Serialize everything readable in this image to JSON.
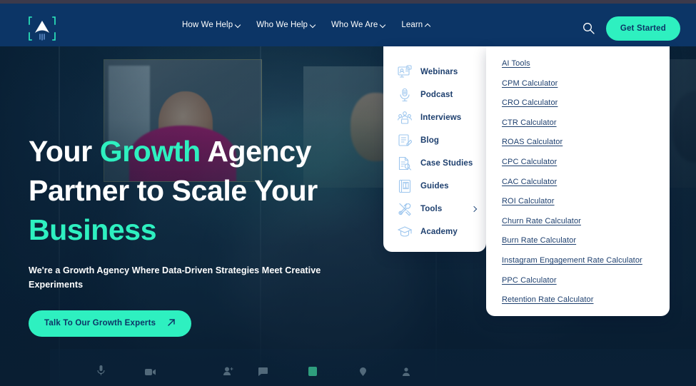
{
  "brand": {
    "logo_icon": "bracket-a-logo",
    "accent_color": "#2ef0c0",
    "header_color": "#0c3566",
    "text_dark": "#1d3f6e"
  },
  "header": {
    "nav": [
      {
        "label": "How We Help",
        "icon": "chevron-down-icon",
        "expanded": false
      },
      {
        "label": "Who We Help",
        "icon": "chevron-down-icon",
        "expanded": false
      },
      {
        "label": "Who We Are",
        "icon": "chevron-down-icon",
        "expanded": false
      },
      {
        "label": "Learn",
        "icon": "chevron-up-icon",
        "expanded": true
      }
    ],
    "search_icon": "search-icon",
    "cta_label": "Get Started"
  },
  "mega_menu": {
    "left_items": [
      {
        "label": "Webinars",
        "icon": "monitor-people-icon",
        "has_submenu": false
      },
      {
        "label": "Podcast",
        "icon": "microphone-icon",
        "has_submenu": false
      },
      {
        "label": "Interviews",
        "icon": "people-group-icon",
        "has_submenu": false
      },
      {
        "label": "Blog",
        "icon": "document-pencil-icon",
        "has_submenu": false
      },
      {
        "label": "Case Studies",
        "icon": "document-magnifier-icon",
        "has_submenu": false
      },
      {
        "label": "Guides",
        "icon": "book-icon",
        "has_submenu": false
      },
      {
        "label": "Tools",
        "icon": "tools-wrench-icon",
        "has_submenu": true
      },
      {
        "label": "Academy",
        "icon": "graduation-cap-icon",
        "has_submenu": false
      }
    ],
    "submenu_arrow_icon": "chevron-right-icon",
    "right_items": [
      "AI Tools",
      "CPM Calculator",
      "CRO Calculator",
      "CTR Calculator",
      "ROAS Calculator",
      "CPC Calculator",
      "CAC Calculator",
      "ROI Calculator",
      "Churn Rate Calculator",
      "Burn Rate Calculator",
      "Instagram Engagement Rate Calculator",
      "PPC Calculator",
      "Retention Rate Calculator"
    ]
  },
  "hero": {
    "heading_part1": "Your ",
    "heading_accent1": "Growth",
    "heading_part2": " Agency Partner to Scale Your ",
    "heading_accent2": "Business",
    "subheading": "We're a Growth Agency Where Data-Driven Strategies Meet Creative Experiments",
    "cta_label": "Talk To Our Growth Experts",
    "cta_icon": "arrow-up-right-icon"
  },
  "call_controls": [
    {
      "icon": "microphone-icon",
      "accent": false
    },
    {
      "icon": "video-camera-icon",
      "accent": false
    },
    {
      "icon": "add-person-icon",
      "accent": false
    },
    {
      "icon": "chat-bubble-icon",
      "accent": false
    },
    {
      "icon": "screen-share-icon",
      "accent": true
    },
    {
      "icon": "info-icon",
      "accent": false
    },
    {
      "icon": "more-icon",
      "accent": false
    }
  ]
}
